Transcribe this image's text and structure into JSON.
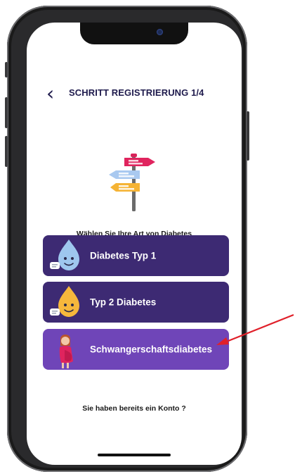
{
  "header": {
    "back_icon": "chevron-left-icon",
    "title": "SCHRITT REGISTRIERUNG 1/4"
  },
  "illustration": {
    "icon": "signpost-icon"
  },
  "prompt": "Wählen Sie Ihre Art von Diabetes",
  "options": [
    {
      "label": "Diabetes Typ 1",
      "icon": "blue-drop-icon",
      "selected": false
    },
    {
      "label": "Typ 2 Diabetes",
      "icon": "yellow-drop-icon",
      "selected": false
    },
    {
      "label": "Schwangerschaftsdiabetes",
      "icon": "pregnant-woman-icon",
      "selected": true
    }
  ],
  "login_link": "Sie haben bereits ein Konto ?",
  "colors": {
    "option_bg": "#3d2a73",
    "option_selected_bg": "#6f45b8",
    "header_text": "#1f1b4d",
    "annotation_arrow": "#e0202a"
  }
}
